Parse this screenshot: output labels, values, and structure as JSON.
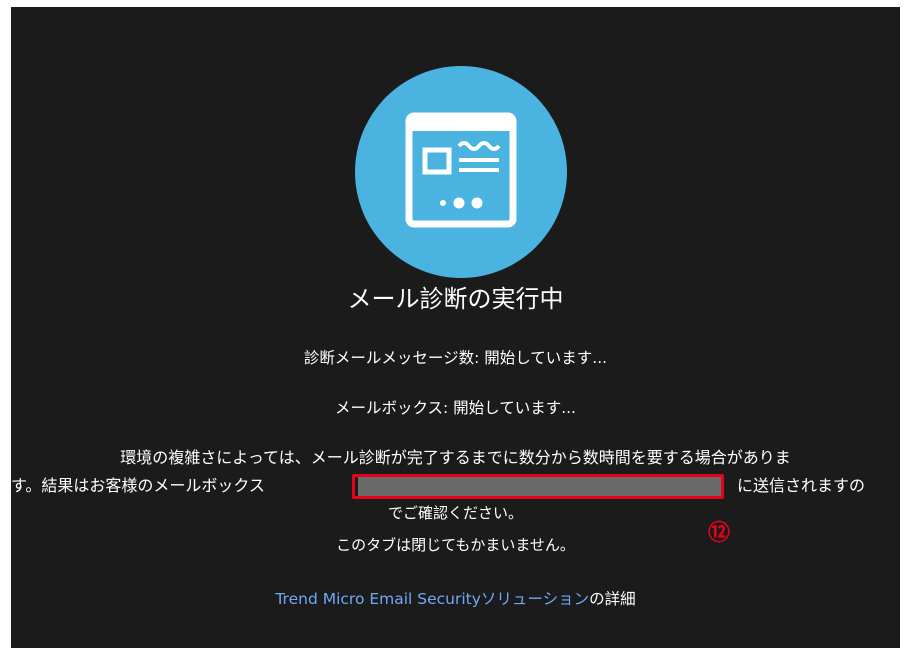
{
  "dialog": {
    "title": "メール診断の実行中",
    "status_messages": [
      "診断メールメッセージ数: 開始しています...",
      "メールボックス: 開始しています..."
    ],
    "notice": {
      "line1": "環境の複雑さによっては、メール診断が完了するまでに数分から数時間を要する場合がありま",
      "line2_before": "す。結果はお客様のメールボックス",
      "line2_after": "に送信されますの",
      "line3": "でご確認ください。",
      "line4": "このタブは閉じてもかまいません。"
    },
    "link": {
      "text": "Trend Micro Email Securityソリューション",
      "suffix": "の詳細"
    }
  },
  "annotation": {
    "marker": "⑫"
  },
  "colors": {
    "panel_bg": "#1b1b1b",
    "hero_circle": "#4ab3df",
    "link": "#6fa9f5",
    "annotation_red": "#e8001a",
    "masked": "#6a6a6a"
  },
  "icons": {
    "hero": "email-window-icon"
  }
}
